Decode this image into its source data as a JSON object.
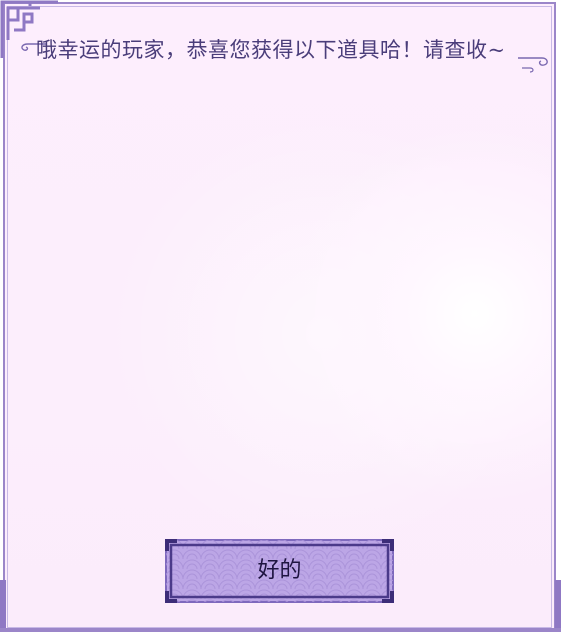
{
  "dialog": {
    "message": "哦幸运的玩家，恭喜您获得以下道具哈！请查收~",
    "confirm_label": "好的"
  },
  "colors": {
    "panel_background": "#fceefc",
    "border": "#9b86c9",
    "button_fill": "#bca6e6",
    "button_border": "#4b3a8a",
    "text": "#4a3d7a"
  },
  "icons": {
    "corner_top_left": "lattice-corner-ornament-icon",
    "title_left": "cloud-curl-ornament-icon",
    "title_right": "cloud-curl-ornament-icon"
  }
}
